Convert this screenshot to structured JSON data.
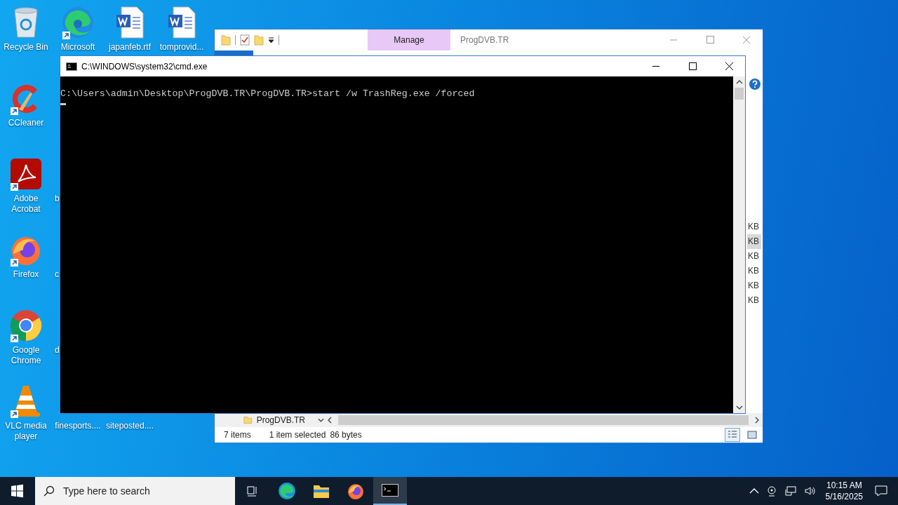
{
  "desktop_icons": [
    {
      "label": "Recycle Bin",
      "kind": "recycle",
      "shortcut": false
    },
    {
      "label": "Microsoft",
      "kind": "edge",
      "shortcut": true
    },
    {
      "label": "japanfeb.rtf",
      "kind": "word",
      "shortcut": false
    },
    {
      "label": "tomprovid...",
      "kind": "word",
      "shortcut": false
    },
    {
      "label": "CCleaner",
      "kind": "ccleaner",
      "shortcut": true
    },
    {
      "label": "Adobe Acrobat",
      "kind": "acrobat",
      "shortcut": true
    },
    {
      "label": "b",
      "kind": "hidden",
      "shortcut": false
    },
    {
      "label": "Firefox",
      "kind": "firefox",
      "shortcut": true
    },
    {
      "label": "c",
      "kind": "hidden",
      "shortcut": false
    },
    {
      "label": "Google Chrome",
      "kind": "chrome",
      "shortcut": true
    },
    {
      "label": "d",
      "kind": "hidden",
      "shortcut": false
    },
    {
      "label": "VLC media player",
      "kind": "vlc",
      "shortcut": true
    },
    {
      "label": "finesports....",
      "kind": "file",
      "shortcut": false
    },
    {
      "label": "siteposted....",
      "kind": "file",
      "shortcut": false
    }
  ],
  "explorer": {
    "title": "ProgDVB.TR",
    "ribbon_tab": "Manage",
    "size_cells": [
      {
        "text": "KB",
        "selected": false
      },
      {
        "text": "KB",
        "selected": true
      },
      {
        "text": "KB",
        "selected": false
      },
      {
        "text": "KB",
        "selected": false
      },
      {
        "text": "KB",
        "selected": false
      },
      {
        "text": "KB",
        "selected": false
      }
    ],
    "nav_item": "ProgDVB.TR",
    "status": {
      "items": "7 items",
      "selection": "1 item selected",
      "size": "86 bytes"
    }
  },
  "console": {
    "title": "C:\\WINDOWS\\system32\\cmd.exe",
    "lines": [
      "C:\\Users\\admin\\Desktop\\ProgDVB.TR\\ProgDVB.TR>start /w TrashReg.exe /forced"
    ]
  },
  "taskbar": {
    "search": {
      "placeholder": "Type here to search"
    },
    "apps": [
      {
        "kind": "taskview",
        "selected": false
      },
      {
        "kind": "edge",
        "selected": false
      },
      {
        "kind": "explorer",
        "selected": false
      },
      {
        "kind": "firefox",
        "selected": false
      },
      {
        "kind": "cmd",
        "selected": true
      }
    ],
    "time": "10:15 AM",
    "date": "5/16/2025"
  }
}
